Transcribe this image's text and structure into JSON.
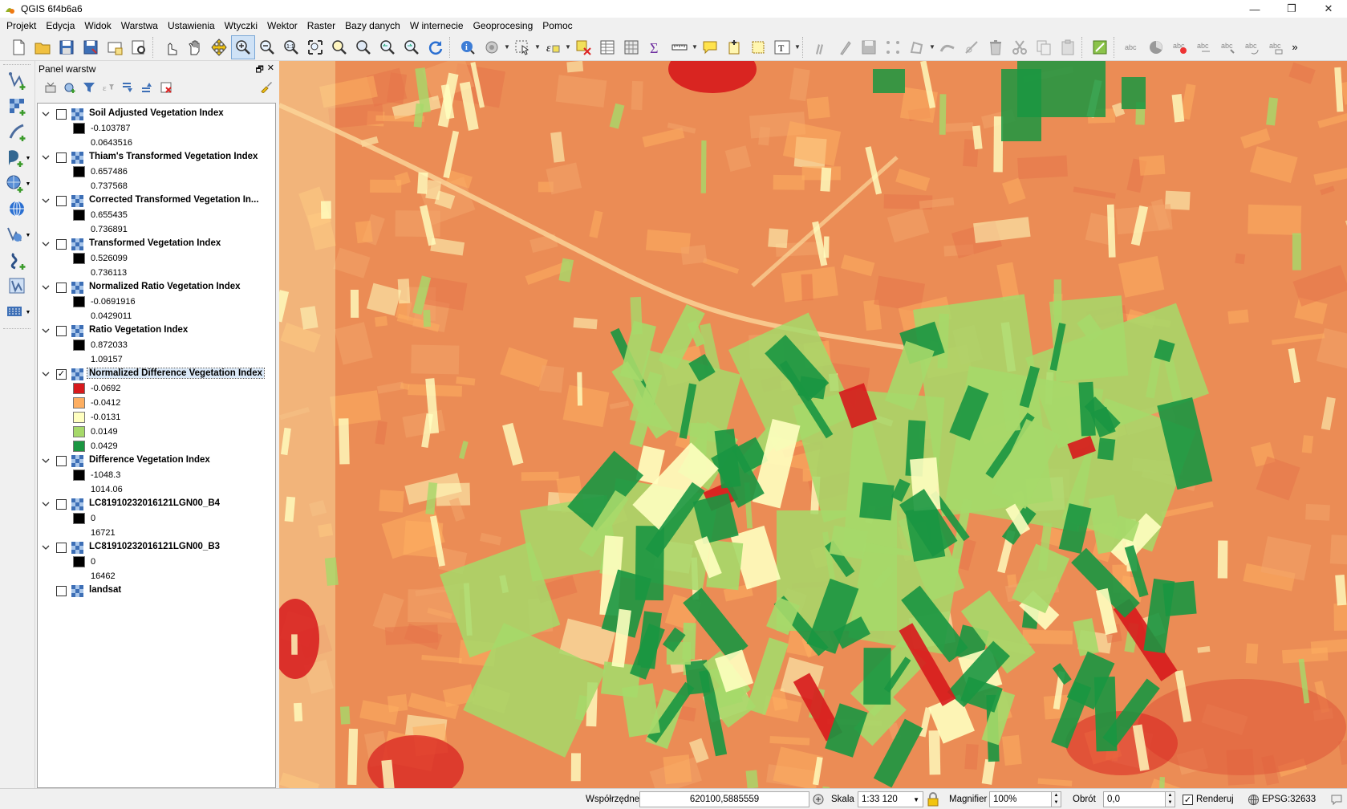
{
  "window": {
    "title": "QGIS 6f4b6a6",
    "minimize": "—",
    "restore": "❐",
    "close": "✕"
  },
  "menu": [
    "Projekt",
    "Edycja",
    "Widok",
    "Warstwa",
    "Ustawienia",
    "Wtyczki",
    "Wektor",
    "Raster",
    "Bazy danych",
    "W internecie",
    "Geoprocesing",
    "Pomoc"
  ],
  "panel": {
    "title": "Panel warstw",
    "float_icon": "🗗",
    "close_icon": "✕"
  },
  "layers": [
    {
      "name": "Soil Adjusted Vegetation Index",
      "checked": false,
      "legend": [
        {
          "color": "#000000",
          "value": "-0.103787"
        },
        {
          "color": null,
          "value": "0.0643516"
        }
      ]
    },
    {
      "name": "Thiam's Transformed Vegetation Index",
      "checked": false,
      "legend": [
        {
          "color": "#000000",
          "value": "0.657486"
        },
        {
          "color": null,
          "value": "0.737568"
        }
      ]
    },
    {
      "name": "Corrected Transformed Vegetation In...",
      "checked": false,
      "legend": [
        {
          "color": "#000000",
          "value": "0.655435"
        },
        {
          "color": null,
          "value": "0.736891"
        }
      ]
    },
    {
      "name": "Transformed Vegetation Index",
      "checked": false,
      "legend": [
        {
          "color": "#000000",
          "value": "0.526099"
        },
        {
          "color": null,
          "value": "0.736113"
        }
      ]
    },
    {
      "name": "Normalized Ratio Vegetation Index",
      "checked": false,
      "legend": [
        {
          "color": "#000000",
          "value": "-0.0691916"
        },
        {
          "color": null,
          "value": "0.0429011"
        }
      ]
    },
    {
      "name": "Ratio Vegetation Index",
      "checked": false,
      "legend": [
        {
          "color": "#000000",
          "value": "0.872033"
        },
        {
          "color": null,
          "value": "1.09157"
        }
      ]
    },
    {
      "name": "Normalized Difference Vegetation Index",
      "checked": true,
      "selected": true,
      "legend": [
        {
          "color": "#d7191c",
          "value": "-0.0692"
        },
        {
          "color": "#fdae61",
          "value": "-0.0412"
        },
        {
          "color": "#ffffc0",
          "value": "-0.0131"
        },
        {
          "color": "#a6d96a",
          "value": "0.0149"
        },
        {
          "color": "#1a9641",
          "value": "0.0429"
        }
      ]
    },
    {
      "name": "Difference Vegetation Index",
      "checked": false,
      "legend": [
        {
          "color": "#000000",
          "value": "-1048.3"
        },
        {
          "color": null,
          "value": "1014.06"
        }
      ]
    },
    {
      "name": "LC81910232016121LGN00_B4",
      "checked": false,
      "legend": [
        {
          "color": "#000000",
          "value": "0"
        },
        {
          "color": null,
          "value": "16721"
        }
      ]
    },
    {
      "name": "LC81910232016121LGN00_B3",
      "checked": false,
      "legend": [
        {
          "color": "#000000",
          "value": "0"
        },
        {
          "color": null,
          "value": "16462"
        }
      ]
    },
    {
      "name": "landsat",
      "checked": false,
      "no_twisty": true,
      "legend": []
    }
  ],
  "status": {
    "coords_label": "Współrzędne",
    "coords_value": "620100,5885559",
    "scale_label": "Skala",
    "scale_value": "1:33 120",
    "magnifier_label": "Magnifier",
    "magnifier_value": "100%",
    "rotation_label": "Obrót",
    "rotation_value": "0,0",
    "render_label": "Renderuj",
    "render_checked": true,
    "crs_label": "EPSG:32633"
  },
  "map_colors": {
    "red": "#d7191c",
    "orange": "#fdae61",
    "yellow": "#ffffc0",
    "lightgreen": "#a6d96a",
    "green": "#1a9641",
    "base": "#eb8c55"
  }
}
